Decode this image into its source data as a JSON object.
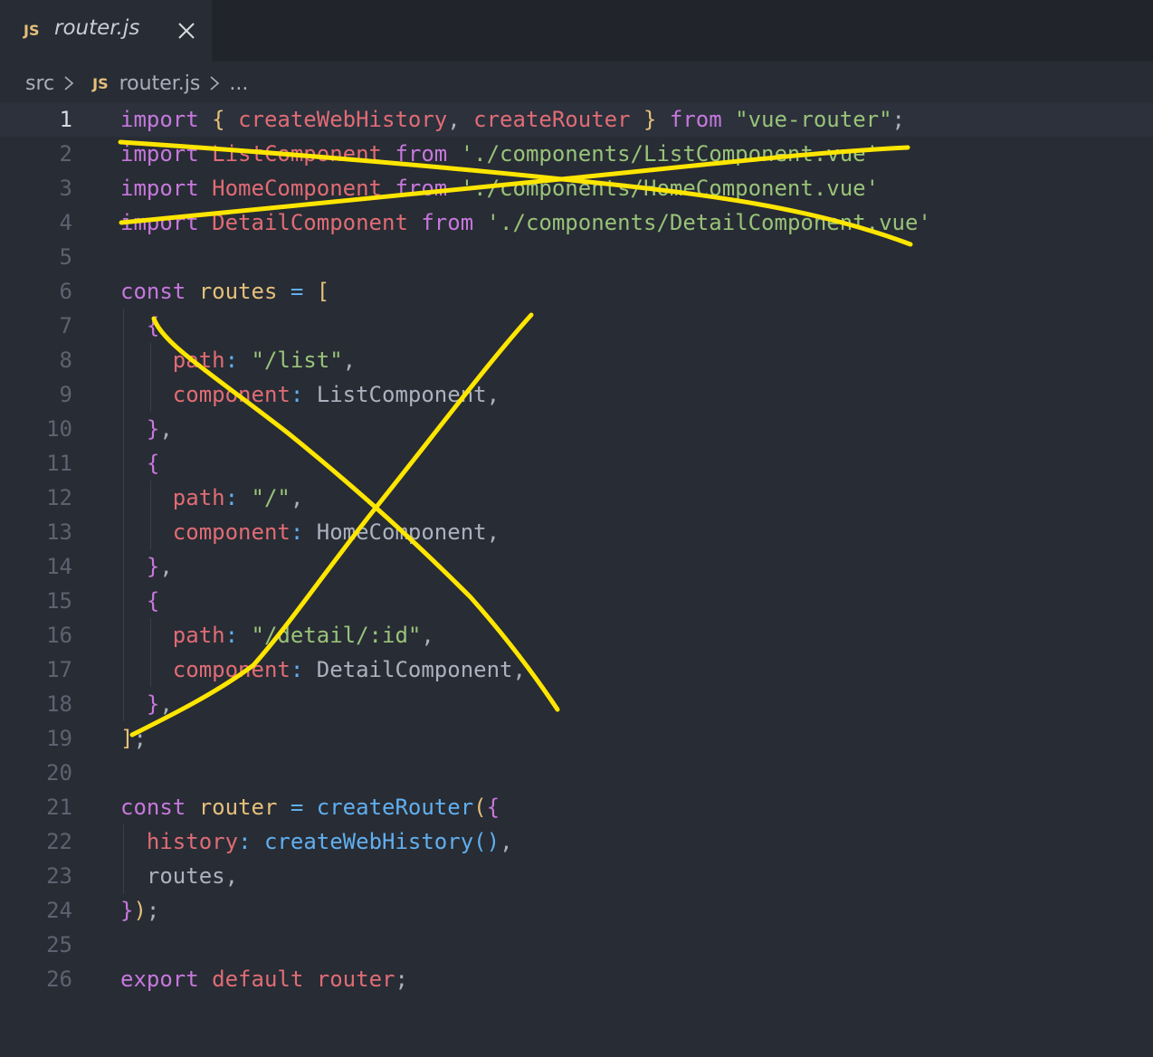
{
  "tab": {
    "icon_text": "JS",
    "name": "router.js"
  },
  "breadcrumb": {
    "folder": "src",
    "icon_text": "JS",
    "file": "router.js",
    "more": "..."
  },
  "colors": {
    "background": "#282c34",
    "keyword": "#c678dd",
    "variable": "#e06c75",
    "string": "#98c379",
    "function": "#61afef",
    "constant": "#e5c07b",
    "plain": "#abb2bf",
    "annotation": "#ffe600"
  },
  "editor": {
    "active_line": 1,
    "lines": [
      {
        "n": "1",
        "tokens": [
          [
            "kw",
            "import"
          ],
          [
            "p",
            " "
          ],
          [
            "b1",
            "{"
          ],
          [
            "p",
            " "
          ],
          [
            "var",
            "createWebHistory"
          ],
          [
            "p",
            ", "
          ],
          [
            "var",
            "createRouter"
          ],
          [
            "p",
            " "
          ],
          [
            "b1",
            "}"
          ],
          [
            "p",
            " "
          ],
          [
            "kw",
            "from"
          ],
          [
            "p",
            " "
          ],
          [
            "str",
            "\"vue-router\""
          ],
          [
            "p",
            ";"
          ]
        ]
      },
      {
        "n": "2",
        "tokens": [
          [
            "kw",
            "import"
          ],
          [
            "p",
            " "
          ],
          [
            "var",
            "ListComponent"
          ],
          [
            "p",
            " "
          ],
          [
            "kw",
            "from"
          ],
          [
            "p",
            " "
          ],
          [
            "str",
            "'./components/ListComponent.vue'"
          ]
        ]
      },
      {
        "n": "3",
        "tokens": [
          [
            "kw",
            "import"
          ],
          [
            "p",
            " "
          ],
          [
            "var",
            "HomeComponent"
          ],
          [
            "p",
            " "
          ],
          [
            "kw",
            "from"
          ],
          [
            "p",
            " "
          ],
          [
            "str",
            "'./components/HomeComponent.vue'"
          ]
        ]
      },
      {
        "n": "4",
        "tokens": [
          [
            "kw",
            "import"
          ],
          [
            "p",
            " "
          ],
          [
            "var",
            "DetailComponent"
          ],
          [
            "p",
            " "
          ],
          [
            "kw",
            "from"
          ],
          [
            "p",
            " "
          ],
          [
            "str",
            "'./components/DetailComponent.vue'"
          ]
        ]
      },
      {
        "n": "5",
        "tokens": []
      },
      {
        "n": "6",
        "tokens": [
          [
            "kw",
            "const"
          ],
          [
            "p",
            " "
          ],
          [
            "cst",
            "routes"
          ],
          [
            "p",
            " "
          ],
          [
            "fn",
            "="
          ],
          [
            "p",
            " "
          ],
          [
            "b1",
            "["
          ]
        ]
      },
      {
        "n": "7",
        "tokens": [
          [
            "p",
            "  "
          ],
          [
            "b2",
            "{"
          ]
        ]
      },
      {
        "n": "8",
        "tokens": [
          [
            "p",
            "    "
          ],
          [
            "var",
            "path"
          ],
          [
            "fn",
            ":"
          ],
          [
            "p",
            " "
          ],
          [
            "str",
            "\"/list\""
          ],
          [
            "p",
            ","
          ]
        ]
      },
      {
        "n": "9",
        "tokens": [
          [
            "p",
            "    "
          ],
          [
            "var",
            "component"
          ],
          [
            "fn",
            ":"
          ],
          [
            "p",
            " ListComponent,"
          ]
        ]
      },
      {
        "n": "10",
        "tokens": [
          [
            "p",
            "  "
          ],
          [
            "b2",
            "}"
          ],
          [
            "p",
            ","
          ]
        ]
      },
      {
        "n": "11",
        "tokens": [
          [
            "p",
            "  "
          ],
          [
            "b2",
            "{"
          ]
        ]
      },
      {
        "n": "12",
        "tokens": [
          [
            "p",
            "    "
          ],
          [
            "var",
            "path"
          ],
          [
            "fn",
            ":"
          ],
          [
            "p",
            " "
          ],
          [
            "str",
            "\"/\""
          ],
          [
            "p",
            ","
          ]
        ]
      },
      {
        "n": "13",
        "tokens": [
          [
            "p",
            "    "
          ],
          [
            "var",
            "component"
          ],
          [
            "fn",
            ":"
          ],
          [
            "p",
            " HomeComponent,"
          ]
        ]
      },
      {
        "n": "14",
        "tokens": [
          [
            "p",
            "  "
          ],
          [
            "b2",
            "}"
          ],
          [
            "p",
            ","
          ]
        ]
      },
      {
        "n": "15",
        "tokens": [
          [
            "p",
            "  "
          ],
          [
            "b2",
            "{"
          ]
        ]
      },
      {
        "n": "16",
        "tokens": [
          [
            "p",
            "    "
          ],
          [
            "var",
            "path"
          ],
          [
            "fn",
            ":"
          ],
          [
            "p",
            " "
          ],
          [
            "str",
            "\"/detail/:id\""
          ],
          [
            "p",
            ","
          ]
        ]
      },
      {
        "n": "17",
        "tokens": [
          [
            "p",
            "    "
          ],
          [
            "var",
            "component"
          ],
          [
            "fn",
            ":"
          ],
          [
            "p",
            " DetailComponent,"
          ]
        ]
      },
      {
        "n": "18",
        "tokens": [
          [
            "p",
            "  "
          ],
          [
            "b2",
            "}"
          ],
          [
            "p",
            ","
          ]
        ]
      },
      {
        "n": "19",
        "tokens": [
          [
            "b1",
            "]"
          ],
          [
            "p",
            ";"
          ]
        ]
      },
      {
        "n": "20",
        "tokens": []
      },
      {
        "n": "21",
        "tokens": [
          [
            "kw",
            "const"
          ],
          [
            "p",
            " "
          ],
          [
            "cst",
            "router"
          ],
          [
            "p",
            " "
          ],
          [
            "fn",
            "="
          ],
          [
            "p",
            " "
          ],
          [
            "fn",
            "createRouter"
          ],
          [
            "b1",
            "("
          ],
          [
            "b2",
            "{"
          ]
        ]
      },
      {
        "n": "22",
        "tokens": [
          [
            "p",
            "  "
          ],
          [
            "var",
            "history"
          ],
          [
            "fn",
            ":"
          ],
          [
            "p",
            " "
          ],
          [
            "fn",
            "createWebHistory"
          ],
          [
            "b3",
            "()"
          ],
          [
            "p",
            ","
          ]
        ]
      },
      {
        "n": "23",
        "tokens": [
          [
            "p",
            "  routes,"
          ]
        ]
      },
      {
        "n": "24",
        "tokens": [
          [
            "b2",
            "}"
          ],
          [
            "b1",
            ")"
          ],
          [
            "p",
            ";"
          ]
        ]
      },
      {
        "n": "25",
        "tokens": []
      },
      {
        "n": "26",
        "tokens": [
          [
            "kw",
            "export"
          ],
          [
            "p",
            " "
          ],
          [
            "var",
            "default"
          ],
          [
            "p",
            " "
          ],
          [
            "var",
            "router"
          ],
          [
            "p",
            ";"
          ]
        ]
      }
    ]
  }
}
